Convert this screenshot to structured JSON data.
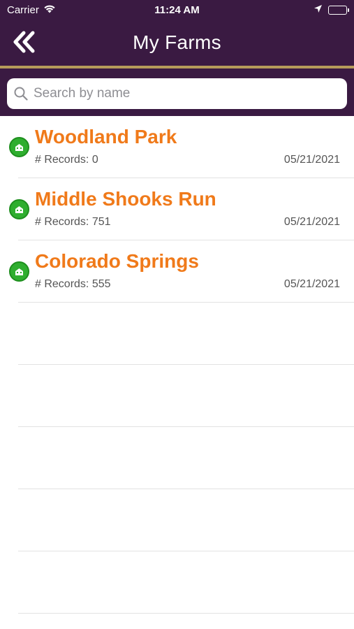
{
  "status_bar": {
    "carrier": "Carrier",
    "time": "11:24 AM"
  },
  "nav": {
    "title": "My Farms",
    "back_icon": "double-chevron-left-icon"
  },
  "search": {
    "placeholder": "Search by name",
    "value": ""
  },
  "farms": [
    {
      "name": "Woodland Park",
      "records": "# Records: 0",
      "date": "05/21/2021"
    },
    {
      "name": "Middle Shooks Run",
      "records": "# Records: 751",
      "date": "05/21/2021"
    },
    {
      "name": "Colorado Springs",
      "records": "# Records: 555",
      "date": "05/21/2021"
    }
  ],
  "colors": {
    "header_bg": "#3a1a42",
    "gold_rule": "#b59a5a",
    "farm_name": "#f07a1a",
    "farm_icon": "#2fae2f"
  }
}
